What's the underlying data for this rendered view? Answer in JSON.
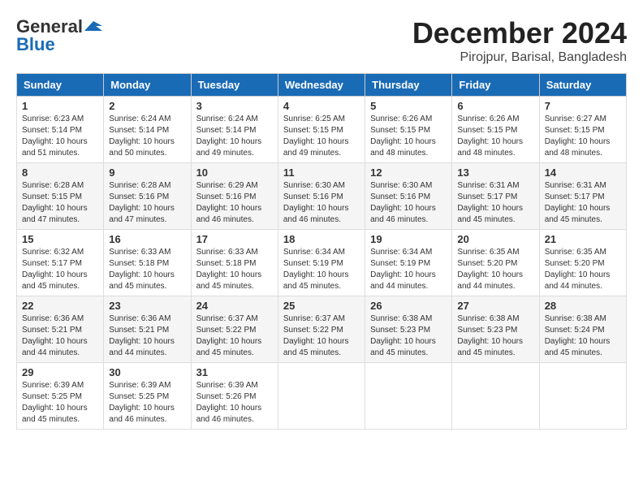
{
  "header": {
    "logo_line1": "General",
    "logo_line2": "Blue",
    "month_title": "December 2024",
    "location": "Pirojpur, Barisal, Bangladesh"
  },
  "weekdays": [
    "Sunday",
    "Monday",
    "Tuesday",
    "Wednesday",
    "Thursday",
    "Friday",
    "Saturday"
  ],
  "weeks": [
    [
      {
        "day": "1",
        "lines": [
          "Sunrise: 6:23 AM",
          "Sunset: 5:14 PM",
          "Daylight: 10 hours",
          "and 51 minutes."
        ]
      },
      {
        "day": "2",
        "lines": [
          "Sunrise: 6:24 AM",
          "Sunset: 5:14 PM",
          "Daylight: 10 hours",
          "and 50 minutes."
        ]
      },
      {
        "day": "3",
        "lines": [
          "Sunrise: 6:24 AM",
          "Sunset: 5:14 PM",
          "Daylight: 10 hours",
          "and 49 minutes."
        ]
      },
      {
        "day": "4",
        "lines": [
          "Sunrise: 6:25 AM",
          "Sunset: 5:15 PM",
          "Daylight: 10 hours",
          "and 49 minutes."
        ]
      },
      {
        "day": "5",
        "lines": [
          "Sunrise: 6:26 AM",
          "Sunset: 5:15 PM",
          "Daylight: 10 hours",
          "and 48 minutes."
        ]
      },
      {
        "day": "6",
        "lines": [
          "Sunrise: 6:26 AM",
          "Sunset: 5:15 PM",
          "Daylight: 10 hours",
          "and 48 minutes."
        ]
      },
      {
        "day": "7",
        "lines": [
          "Sunrise: 6:27 AM",
          "Sunset: 5:15 PM",
          "Daylight: 10 hours",
          "and 48 minutes."
        ]
      }
    ],
    [
      {
        "day": "8",
        "lines": [
          "Sunrise: 6:28 AM",
          "Sunset: 5:15 PM",
          "Daylight: 10 hours",
          "and 47 minutes."
        ]
      },
      {
        "day": "9",
        "lines": [
          "Sunrise: 6:28 AM",
          "Sunset: 5:16 PM",
          "Daylight: 10 hours",
          "and 47 minutes."
        ]
      },
      {
        "day": "10",
        "lines": [
          "Sunrise: 6:29 AM",
          "Sunset: 5:16 PM",
          "Daylight: 10 hours",
          "and 46 minutes."
        ]
      },
      {
        "day": "11",
        "lines": [
          "Sunrise: 6:30 AM",
          "Sunset: 5:16 PM",
          "Daylight: 10 hours",
          "and 46 minutes."
        ]
      },
      {
        "day": "12",
        "lines": [
          "Sunrise: 6:30 AM",
          "Sunset: 5:16 PM",
          "Daylight: 10 hours",
          "and 46 minutes."
        ]
      },
      {
        "day": "13",
        "lines": [
          "Sunrise: 6:31 AM",
          "Sunset: 5:17 PM",
          "Daylight: 10 hours",
          "and 45 minutes."
        ]
      },
      {
        "day": "14",
        "lines": [
          "Sunrise: 6:31 AM",
          "Sunset: 5:17 PM",
          "Daylight: 10 hours",
          "and 45 minutes."
        ]
      }
    ],
    [
      {
        "day": "15",
        "lines": [
          "Sunrise: 6:32 AM",
          "Sunset: 5:17 PM",
          "Daylight: 10 hours",
          "and 45 minutes."
        ]
      },
      {
        "day": "16",
        "lines": [
          "Sunrise: 6:33 AM",
          "Sunset: 5:18 PM",
          "Daylight: 10 hours",
          "and 45 minutes."
        ]
      },
      {
        "day": "17",
        "lines": [
          "Sunrise: 6:33 AM",
          "Sunset: 5:18 PM",
          "Daylight: 10 hours",
          "and 45 minutes."
        ]
      },
      {
        "day": "18",
        "lines": [
          "Sunrise: 6:34 AM",
          "Sunset: 5:19 PM",
          "Daylight: 10 hours",
          "and 45 minutes."
        ]
      },
      {
        "day": "19",
        "lines": [
          "Sunrise: 6:34 AM",
          "Sunset: 5:19 PM",
          "Daylight: 10 hours",
          "and 44 minutes."
        ]
      },
      {
        "day": "20",
        "lines": [
          "Sunrise: 6:35 AM",
          "Sunset: 5:20 PM",
          "Daylight: 10 hours",
          "and 44 minutes."
        ]
      },
      {
        "day": "21",
        "lines": [
          "Sunrise: 6:35 AM",
          "Sunset: 5:20 PM",
          "Daylight: 10 hours",
          "and 44 minutes."
        ]
      }
    ],
    [
      {
        "day": "22",
        "lines": [
          "Sunrise: 6:36 AM",
          "Sunset: 5:21 PM",
          "Daylight: 10 hours",
          "and 44 minutes."
        ]
      },
      {
        "day": "23",
        "lines": [
          "Sunrise: 6:36 AM",
          "Sunset: 5:21 PM",
          "Daylight: 10 hours",
          "and 44 minutes."
        ]
      },
      {
        "day": "24",
        "lines": [
          "Sunrise: 6:37 AM",
          "Sunset: 5:22 PM",
          "Daylight: 10 hours",
          "and 45 minutes."
        ]
      },
      {
        "day": "25",
        "lines": [
          "Sunrise: 6:37 AM",
          "Sunset: 5:22 PM",
          "Daylight: 10 hours",
          "and 45 minutes."
        ]
      },
      {
        "day": "26",
        "lines": [
          "Sunrise: 6:38 AM",
          "Sunset: 5:23 PM",
          "Daylight: 10 hours",
          "and 45 minutes."
        ]
      },
      {
        "day": "27",
        "lines": [
          "Sunrise: 6:38 AM",
          "Sunset: 5:23 PM",
          "Daylight: 10 hours",
          "and 45 minutes."
        ]
      },
      {
        "day": "28",
        "lines": [
          "Sunrise: 6:38 AM",
          "Sunset: 5:24 PM",
          "Daylight: 10 hours",
          "and 45 minutes."
        ]
      }
    ],
    [
      {
        "day": "29",
        "lines": [
          "Sunrise: 6:39 AM",
          "Sunset: 5:25 PM",
          "Daylight: 10 hours",
          "and 45 minutes."
        ]
      },
      {
        "day": "30",
        "lines": [
          "Sunrise: 6:39 AM",
          "Sunset: 5:25 PM",
          "Daylight: 10 hours",
          "and 46 minutes."
        ]
      },
      {
        "day": "31",
        "lines": [
          "Sunrise: 6:39 AM",
          "Sunset: 5:26 PM",
          "Daylight: 10 hours",
          "and 46 minutes."
        ]
      },
      null,
      null,
      null,
      null
    ]
  ]
}
